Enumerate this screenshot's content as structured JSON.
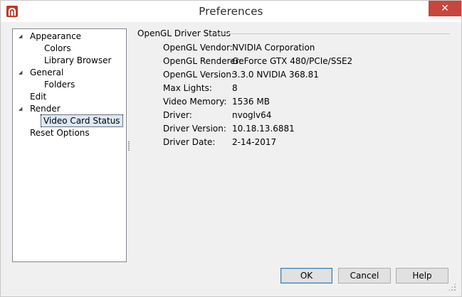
{
  "window": {
    "title": "Preferences",
    "close_glyph": "✕"
  },
  "tree": {
    "items": [
      {
        "label": "Appearance",
        "expanded": true
      },
      {
        "label": "Colors"
      },
      {
        "label": "Library Browser"
      },
      {
        "label": "General",
        "expanded": true
      },
      {
        "label": "Folders"
      },
      {
        "label": "Edit"
      },
      {
        "label": "Render",
        "expanded": true
      },
      {
        "label": "Video Card Status",
        "selected": true
      },
      {
        "label": "Reset Options"
      }
    ],
    "expanded_glyph": "◢"
  },
  "group": {
    "title": "OpenGL Driver Status",
    "rows": [
      {
        "label": "OpenGL Vendor:",
        "value": "NVIDIA Corporation"
      },
      {
        "label": "OpenGL Renderer:",
        "value": "GeForce GTX 480/PCIe/SSE2"
      },
      {
        "label": "OpenGL Version:",
        "value": "3.3.0 NVIDIA 368.81"
      },
      {
        "label": "Max Lights:",
        "value": "8"
      },
      {
        "label": "Video Memory:",
        "value": "1536 MB"
      },
      {
        "label": "Driver:",
        "value": "nvoglv64"
      },
      {
        "label": "Driver Version:",
        "value": "10.18.13.6881"
      },
      {
        "label": "Driver Date:",
        "value": "2-14-2017"
      }
    ]
  },
  "buttons": {
    "ok": "OK",
    "cancel": "Cancel",
    "help": "Help"
  },
  "colors": {
    "close_button": "#c7463d",
    "selection": "#dbe8f7",
    "app_icon": "#c0392b"
  },
  "icons": {
    "app": "app-logo-icon",
    "close": "close-icon",
    "expand": "expanded-triangle-icon",
    "resize": "resize-grip-icon"
  }
}
